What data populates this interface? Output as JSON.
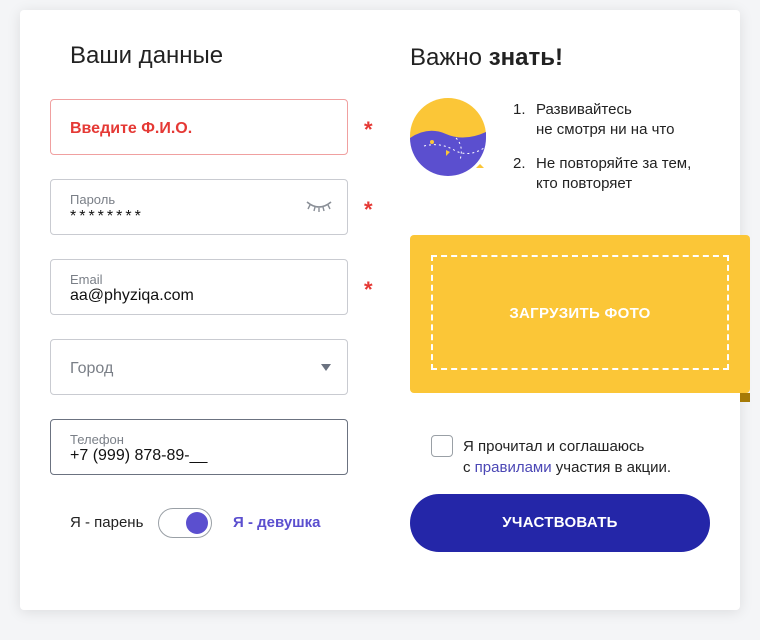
{
  "left": {
    "title": "Ваши данные",
    "fields": {
      "fio": {
        "error_text": "Введите Ф.И.О.",
        "required_mark": "*"
      },
      "password": {
        "label": "Пароль",
        "value": "********",
        "required_mark": "*"
      },
      "email": {
        "label": "Email",
        "value": "aa@phyziqa.com",
        "required_mark": "*"
      },
      "city": {
        "placeholder": "Город"
      },
      "phone": {
        "label": "Телефон",
        "value": "+7 (999) 878-89-__"
      }
    },
    "gender": {
      "left": "Я - парень",
      "right": "Я - девушка",
      "selected": "Я - девушка"
    }
  },
  "right": {
    "title_prefix": "Важно ",
    "title_bold": "знать!",
    "tips": [
      {
        "num": "1.",
        "line1": "Развивайтесь",
        "line2": "не смотря ни на что"
      },
      {
        "num": "2.",
        "line1": "Не повторяйте за тем,",
        "line2": "кто повторяет"
      }
    ],
    "upload_label": "ЗАГРУЗИТЬ ФОТО",
    "agree": {
      "before": "Я прочитал и соглашаюсь",
      "prefix": "с ",
      "link": "правилами",
      "after": " участия в акции."
    },
    "submit_label": "УЧАСТВОВАТЬ"
  },
  "colors": {
    "error": "#e53935",
    "accent_purple": "#5b4fcf",
    "upload_yellow": "#fbc637",
    "submit_blue": "#2426a8"
  }
}
